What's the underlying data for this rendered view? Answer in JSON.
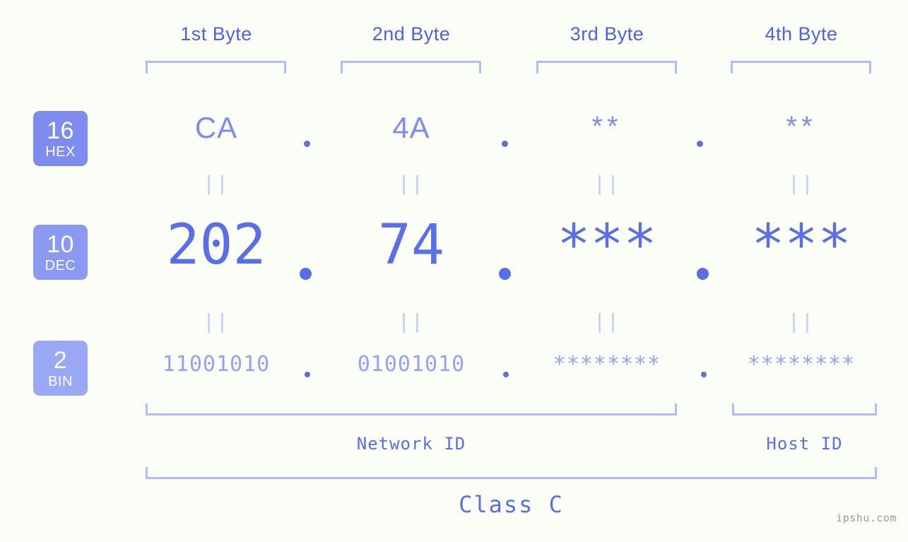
{
  "header": {
    "byte_labels": [
      {
        "label": "1st Byte"
      },
      {
        "label": "2nd Byte"
      },
      {
        "label": "3rd Byte"
      },
      {
        "label": "4th Byte"
      }
    ]
  },
  "badges": [
    {
      "num": "16",
      "abbr": "HEX",
      "color": "#7d8cee"
    },
    {
      "num": "10",
      "abbr": "DEC",
      "color": "#8b99f0"
    },
    {
      "num": "2",
      "abbr": "BIN",
      "color": "#9aa8f5"
    }
  ],
  "rows": {
    "hex": {
      "values": [
        "CA",
        "4A",
        "**",
        "**"
      ]
    },
    "dec": {
      "values": [
        "202",
        "74",
        "***",
        "***"
      ]
    },
    "bin": {
      "values": [
        "11001010",
        "01001010",
        "********",
        "********"
      ]
    }
  },
  "separators": {
    "dot": ".",
    "equals": "||"
  },
  "footer": {
    "network_id_label": "Network ID",
    "host_id_label": "Host ID",
    "class_label": "Class C",
    "watermark": "ipshu.com"
  },
  "colors": {
    "background": "#fbfdf7",
    "accent_strong": "#5a6ee8",
    "accent_mid": "#7d8cee",
    "accent_light": "#94a2f3",
    "bracket": "#b3bdf5",
    "watermark": "#9a9a9a"
  }
}
